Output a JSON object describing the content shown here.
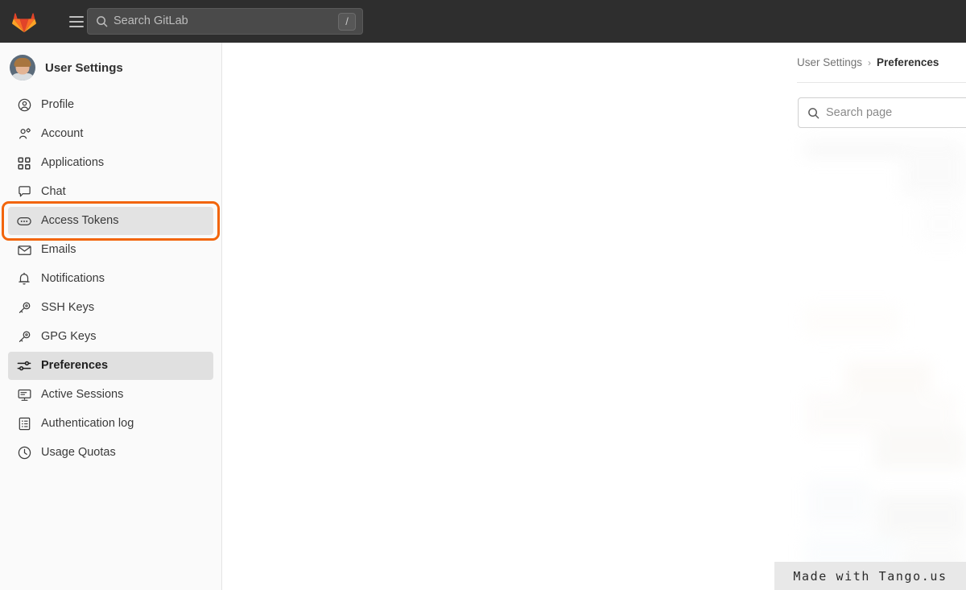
{
  "topbar": {
    "logo_icon": "gitlab-tanuki-logo",
    "menu_icon": "hamburger-menu-icon",
    "search": {
      "icon": "search-icon",
      "placeholder": "Search GitLab",
      "shortcut_key": "/"
    }
  },
  "sidebar": {
    "avatar_icon": "user-avatar",
    "title": "User Settings",
    "items": [
      {
        "label": "Profile",
        "icon": "user-circle-icon",
        "state": "default"
      },
      {
        "label": "Account",
        "icon": "user-gear-icon",
        "state": "default"
      },
      {
        "label": "Applications",
        "icon": "grid-squares-icon",
        "state": "default"
      },
      {
        "label": "Chat",
        "icon": "chat-bubble-icon",
        "state": "default"
      },
      {
        "label": "Access Tokens",
        "icon": "token-pill-icon",
        "state": "highlighted"
      },
      {
        "label": "Emails",
        "icon": "envelope-icon",
        "state": "default"
      },
      {
        "label": "Notifications",
        "icon": "bell-icon",
        "state": "default"
      },
      {
        "label": "SSH Keys",
        "icon": "key-icon",
        "state": "default"
      },
      {
        "label": "GPG Keys",
        "icon": "key-icon",
        "state": "default"
      },
      {
        "label": "Preferences",
        "icon": "sliders-icon",
        "state": "active"
      },
      {
        "label": "Active Sessions",
        "icon": "monitor-icon",
        "state": "default"
      },
      {
        "label": "Authentication log",
        "icon": "log-list-icon",
        "state": "default"
      },
      {
        "label": "Usage Quotas",
        "icon": "clock-icon",
        "state": "default"
      }
    ]
  },
  "main": {
    "breadcrumb": {
      "parent": "User Settings",
      "separator": "›",
      "current": "Preferences"
    },
    "search_page": {
      "icon": "search-icon",
      "placeholder": "Search page"
    }
  },
  "watermark": {
    "text": "Made with Tango.us"
  },
  "colors": {
    "topbar_background": "#2e2e2e",
    "sidebar_background": "#fafafa",
    "highlight_ring": "#f2650b",
    "active_item_background": "#e0e0e0",
    "watermark_background": "#e8e8e8"
  }
}
